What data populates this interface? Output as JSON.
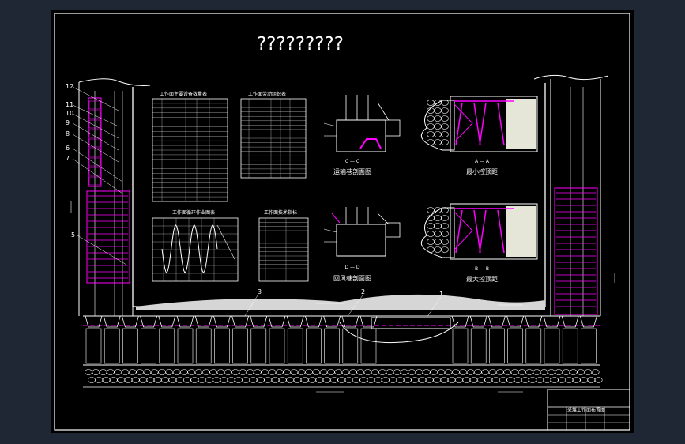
{
  "drawing": {
    "title": "?????????",
    "colors": {
      "background": "#000000",
      "frame": "#ffffff",
      "accent": "#ff00ff",
      "outer": "#1f2735"
    }
  },
  "callouts": {
    "left": [
      "12",
      "11",
      "10",
      "9",
      "8",
      "7",
      "6",
      "5"
    ],
    "bottom": [
      "3",
      "2",
      "1"
    ]
  },
  "sections": {
    "c_c": {
      "mark": "C — C",
      "caption": "运输巷剖面图"
    },
    "d_d": {
      "mark": "D — D",
      "caption": "回风巷剖面图"
    },
    "a_a": {
      "mark": "A — A",
      "caption": "最小控顶距"
    },
    "b_b": {
      "mark": "B — B",
      "caption": "最大控顶距"
    }
  },
  "tables": {
    "t1": {
      "title": "工作面主要设备数量表"
    },
    "t2": {
      "title": "工作面劳动组织表"
    },
    "t3": {
      "title": "工作面循环作业图表"
    },
    "t4": {
      "title": "工作面技术指标"
    }
  },
  "title_block": {
    "name": "采煤工作面布置图"
  }
}
